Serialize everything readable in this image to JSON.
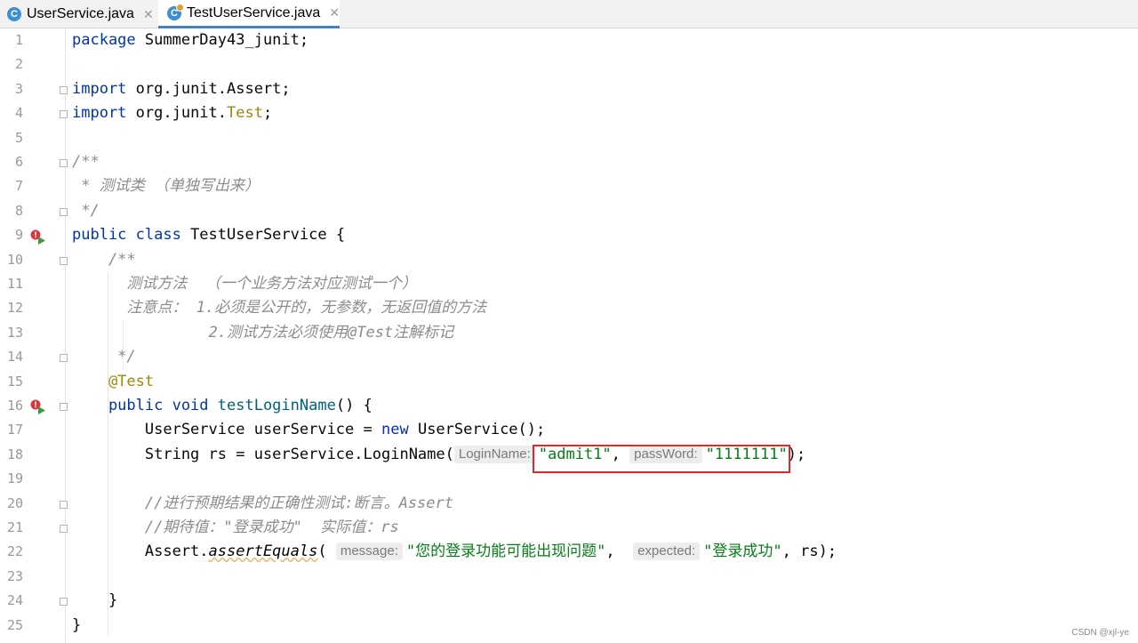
{
  "tabs": [
    {
      "label": "UserService.java",
      "icon": "java-class-icon",
      "active": false
    },
    {
      "label": "TestUserService.java",
      "icon": "java-test-class-icon",
      "active": true
    }
  ],
  "close_glyph": "✕",
  "line_numbers": [
    "1",
    "2",
    "3",
    "4",
    "5",
    "6",
    "7",
    "8",
    "9",
    "10",
    "11",
    "12",
    "13",
    "14",
    "15",
    "16",
    "17",
    "18",
    "19",
    "20",
    "21",
    "22",
    "23",
    "24",
    "25"
  ],
  "code": {
    "l1": {
      "kw": "package",
      "rest": " SummerDay43_junit;"
    },
    "l3": {
      "kw": "import",
      "rest": " org.junit.Assert;"
    },
    "l4": {
      "kw": "import",
      "rest": " org.junit.",
      "ann": "Test",
      "end": ";"
    },
    "l6": "/**",
    "l7": " * 测试类 （单独写出来）",
    "l8": " */",
    "l9": {
      "kw": "public class",
      "rest": " TestUserService {"
    },
    "l10": "    /**",
    "l11": "      测试方法  （一个业务方法对应测试一个）",
    "l12": "      注意点： 1.必须是公开的，无参数，无返回值的方法",
    "l13": "               2.测试方法必须使用@Test注解标记",
    "l14": "     */",
    "l15": "    @Test",
    "l16": {
      "kw": "    public void",
      "fn": " testLoginName",
      "rest": "() {"
    },
    "l17": {
      "pre": "        UserService userService = ",
      "kw": "new",
      "rest": " UserService();"
    },
    "l18": {
      "pre": "        String rs = userService.LoginName(",
      "hint1": "LoginName:",
      "s1": "\"admit1\"",
      "comma": ", ",
      "hint2": "passWord:",
      "s2": "\"1111111\"",
      "end": ");"
    },
    "l20": "        //进行预期结果的正确性测试:断言。Assert",
    "l21": "        //期待值：\"登录成功\"  实际值：rs",
    "l22": {
      "pre": "        Assert.",
      "stat": "assertEquals",
      "open": "( ",
      "hint1": "message:",
      "s1": "\"您的登录功能可能出现问题\"",
      "comma": ",  ",
      "hint2": "expected:",
      "s2": "\"登录成功\"",
      "end": ", rs);"
    },
    "l24": "    }",
    "l25": "}"
  },
  "watermark": "CSDN @xjl-ye",
  "colors": {
    "keyword": "#0033b3",
    "annotation": "#9e880d",
    "string": "#067d17",
    "comment": "#8c8c8c",
    "highlight_box": "#e02a2a"
  }
}
